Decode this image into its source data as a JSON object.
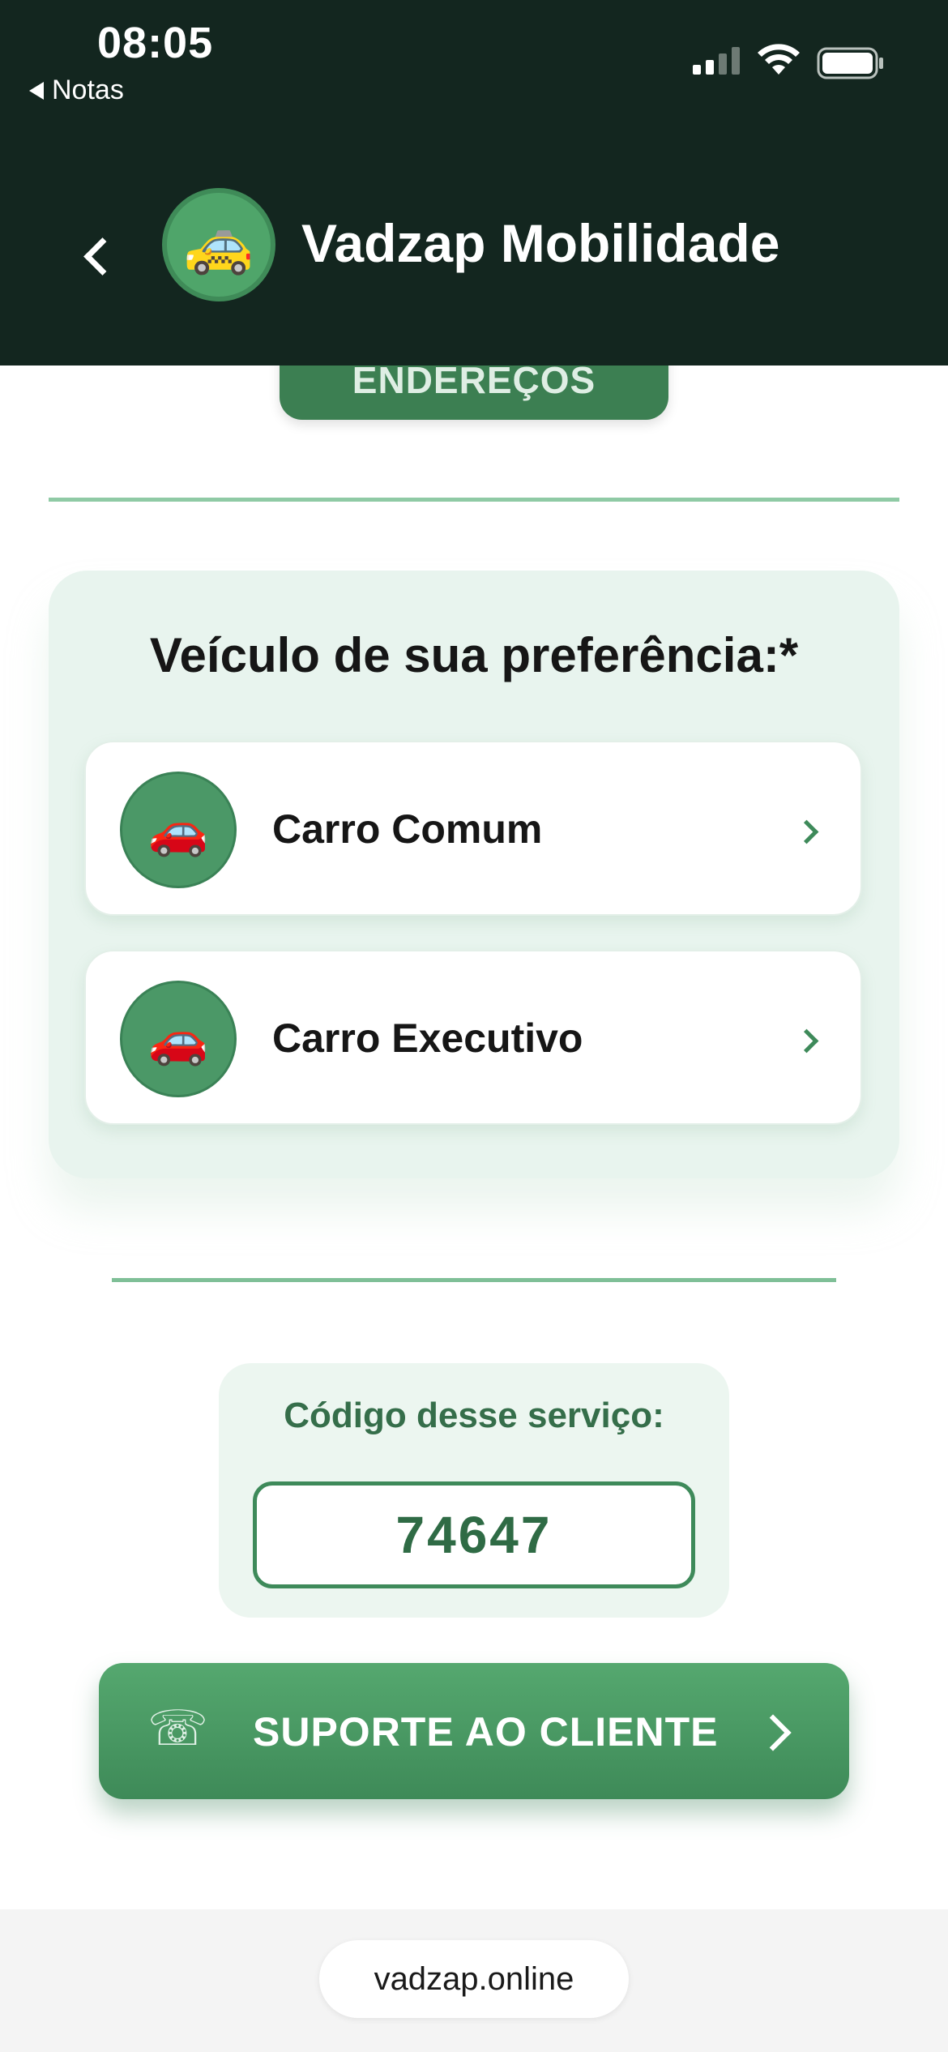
{
  "status_bar": {
    "time": "08:05",
    "back_app": "Notas"
  },
  "header": {
    "title": "Vadzap Mobilidade",
    "logo_icon": "🚕"
  },
  "address_tab": {
    "label": "ENDEREÇOS"
  },
  "vehicle_preference": {
    "title": "Veículo de sua preferência:*",
    "options": [
      {
        "label": "Carro Comum",
        "icon": "🚗"
      },
      {
        "label": "Carro Executivo",
        "icon": "🚗"
      }
    ]
  },
  "service_code": {
    "label": "Código desse serviço:",
    "value": "74647"
  },
  "support_button": {
    "label": "SUPORTE AO CLIENTE",
    "icon": "☏"
  },
  "browser": {
    "url": "vadzap.online"
  },
  "colors": {
    "header_bg": "#13261f",
    "accent_green": "#3e8a5a",
    "card_bg": "#e8f4ee"
  }
}
